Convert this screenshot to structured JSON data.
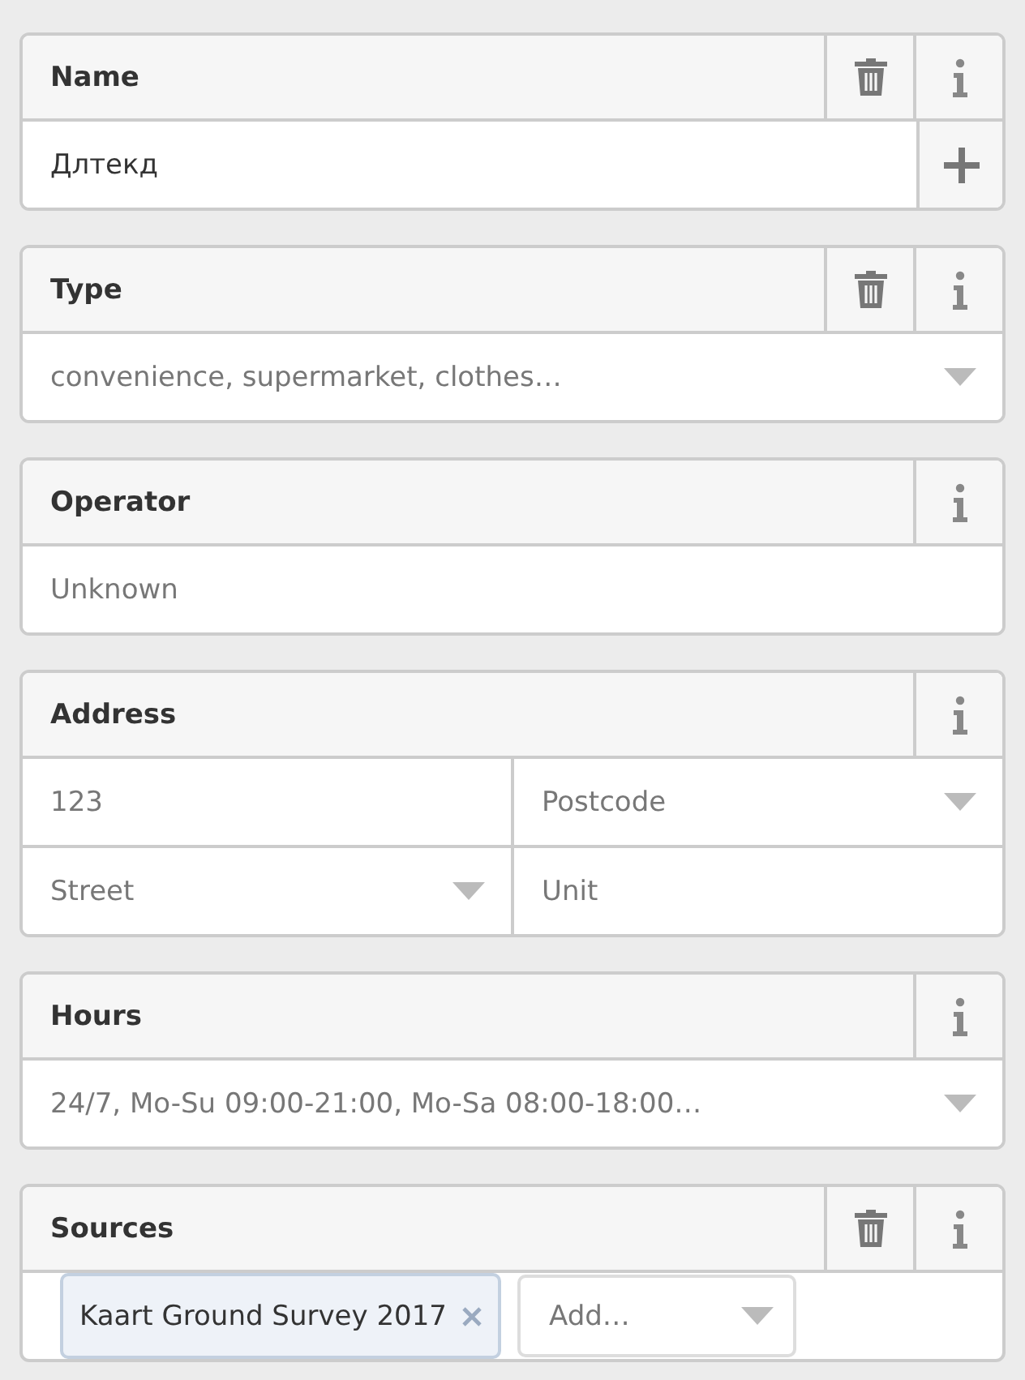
{
  "fields": [
    {
      "label": "Name",
      "removable": true,
      "addable": true,
      "rows": [
        [
          {
            "kind": "text",
            "value": "Длтекд"
          }
        ]
      ]
    },
    {
      "label": "Type",
      "removable": true,
      "addable": false,
      "rows": [
        [
          {
            "kind": "combo",
            "placeholder": "convenience, supermarket, clothes…"
          }
        ]
      ]
    },
    {
      "label": "Operator",
      "removable": false,
      "addable": false,
      "rows": [
        [
          {
            "kind": "text",
            "placeholder": "Unknown"
          }
        ]
      ]
    },
    {
      "label": "Address",
      "removable": false,
      "addable": false,
      "rows": [
        [
          {
            "kind": "text",
            "placeholder": "123"
          },
          {
            "kind": "combo",
            "placeholder": "Postcode"
          }
        ],
        [
          {
            "kind": "combo",
            "placeholder": "Street"
          },
          {
            "kind": "text",
            "placeholder": "Unit"
          }
        ]
      ]
    },
    {
      "label": "Hours",
      "removable": false,
      "addable": false,
      "rows": [
        [
          {
            "kind": "combo",
            "placeholder": "24/7, Mo-Su 09:00-21:00, Mo-Sa 08:00-18:00…"
          }
        ]
      ]
    },
    {
      "label": "Sources",
      "removable": true,
      "addable": false,
      "rows": [
        [
          {
            "kind": "chips",
            "chips": [
              "Kaart Ground Survey 2017"
            ],
            "placeholder": "Add…"
          }
        ]
      ]
    }
  ]
}
